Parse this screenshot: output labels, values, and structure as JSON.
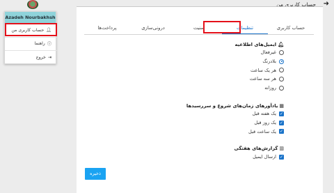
{
  "header": {
    "title": "حساب کاربری من",
    "back_icon": "arrow-right-icon"
  },
  "user": {
    "name": "Azadeh Nourbakhsh"
  },
  "menu": {
    "items": [
      {
        "label": "حساب کاربری من",
        "icon": "user-icon"
      },
      {
        "label": "راهنما",
        "icon": "help-icon"
      },
      {
        "label": "خروج",
        "icon": "logout-icon"
      }
    ]
  },
  "tabs": [
    {
      "label": "حساب کاربری",
      "active": false
    },
    {
      "label": "تنظیمات",
      "active": true
    },
    {
      "label": "امنیت",
      "active": false
    },
    {
      "label": "درونی‌سازی",
      "active": false
    },
    {
      "label": "پرداخت‌ها",
      "active": false
    }
  ],
  "notifications": {
    "title": "ایمیل‌های اطلاعیه",
    "options": [
      "غیرفعال",
      "بلادرنگ",
      "هر یک ساعت",
      "هر سه ساعت",
      "روزانه"
    ],
    "selected": "بلادرنگ"
  },
  "reminders": {
    "title": "یادآورهای زمان‌های شروع و سررسیدها",
    "options": [
      "یک هفته قبل",
      "یک روز قبل",
      "یک ساعت قبل"
    ]
  },
  "weekly_reports": {
    "title": "گزارش‌های هفتگی",
    "options": [
      "ارسال ایمیل"
    ]
  },
  "save_label": "ذخیره",
  "colors": {
    "accent": "#1a73c9",
    "button": "#1aa3f2",
    "menu_header": "#8fd3da",
    "highlight": "#e4101a"
  }
}
